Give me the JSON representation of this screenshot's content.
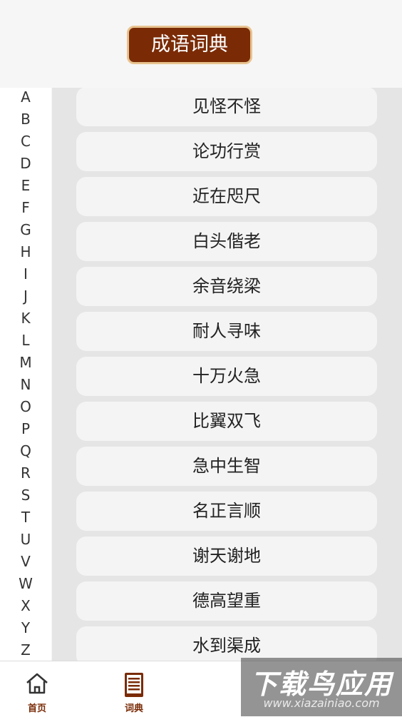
{
  "header": {
    "title": "成语词典"
  },
  "alphabet": [
    "A",
    "B",
    "C",
    "D",
    "E",
    "F",
    "G",
    "H",
    "I",
    "J",
    "K",
    "L",
    "M",
    "N",
    "O",
    "P",
    "Q",
    "R",
    "S",
    "T",
    "U",
    "V",
    "W",
    "X",
    "Y",
    "Z"
  ],
  "idioms": [
    "见怪不怪",
    "论功行赏",
    "近在咫尺",
    "白头偕老",
    "余音绕梁",
    "耐人寻味",
    "十万火急",
    "比翼双飞",
    "急中生智",
    "名正言顺",
    "谢天谢地",
    "德高望重",
    "水到渠成"
  ],
  "tabbar": {
    "home_label": "首页",
    "dict_label": "词典",
    "active_color": "#7a2b06",
    "home_color": "#7a2b06"
  },
  "watermark": {
    "main": "下载鸟应用",
    "sub": "www.xiazainiao.com"
  }
}
